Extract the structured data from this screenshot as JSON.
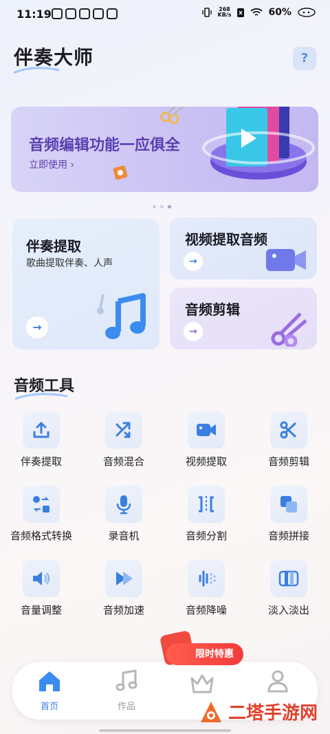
{
  "status_bar": {
    "time": "11:19",
    "speed_top": "268",
    "speed_bottom": "KB/s",
    "battery": "60%"
  },
  "header": {
    "title": "伴奏大师",
    "help_label": "?"
  },
  "banner": {
    "title": "音频编辑功能一应俱全",
    "cta": "立即使用"
  },
  "feature_cards": {
    "accompaniment": {
      "title": "伴奏提取",
      "subtitle": "歌曲提取伴奏、人声"
    },
    "video_audio": {
      "title": "视频提取音频"
    },
    "audio_edit": {
      "title": "音频剪辑"
    },
    "arrow": "→"
  },
  "tools": {
    "section_title": "音频工具",
    "items": [
      {
        "label": "伴奏提取",
        "icon": "upload-icon"
      },
      {
        "label": "音频混合",
        "icon": "shuffle-icon"
      },
      {
        "label": "视频提取",
        "icon": "video-camera-icon"
      },
      {
        "label": "音频剪辑",
        "icon": "scissors-icon"
      },
      {
        "label": "音频格式转换",
        "icon": "convert-icon"
      },
      {
        "label": "录音机",
        "icon": "microphone-icon"
      },
      {
        "label": "音频分割",
        "icon": "split-icon"
      },
      {
        "label": "音频拼接",
        "icon": "merge-icon"
      },
      {
        "label": "音量调整",
        "icon": "volume-icon"
      },
      {
        "label": "音频加速",
        "icon": "fast-forward-icon"
      },
      {
        "label": "音频降噪",
        "icon": "noise-reduction-icon"
      },
      {
        "label": "淡入淡出",
        "icon": "fade-icon"
      }
    ]
  },
  "bottom_nav": {
    "home": "首页",
    "works": "作品",
    "promo": "限时特惠"
  },
  "watermark": "二塔手游网",
  "colors": {
    "accent_blue": "#3a7fe0",
    "banner_purple": "#5b3fb0",
    "promo_red": "#f23b3b"
  }
}
